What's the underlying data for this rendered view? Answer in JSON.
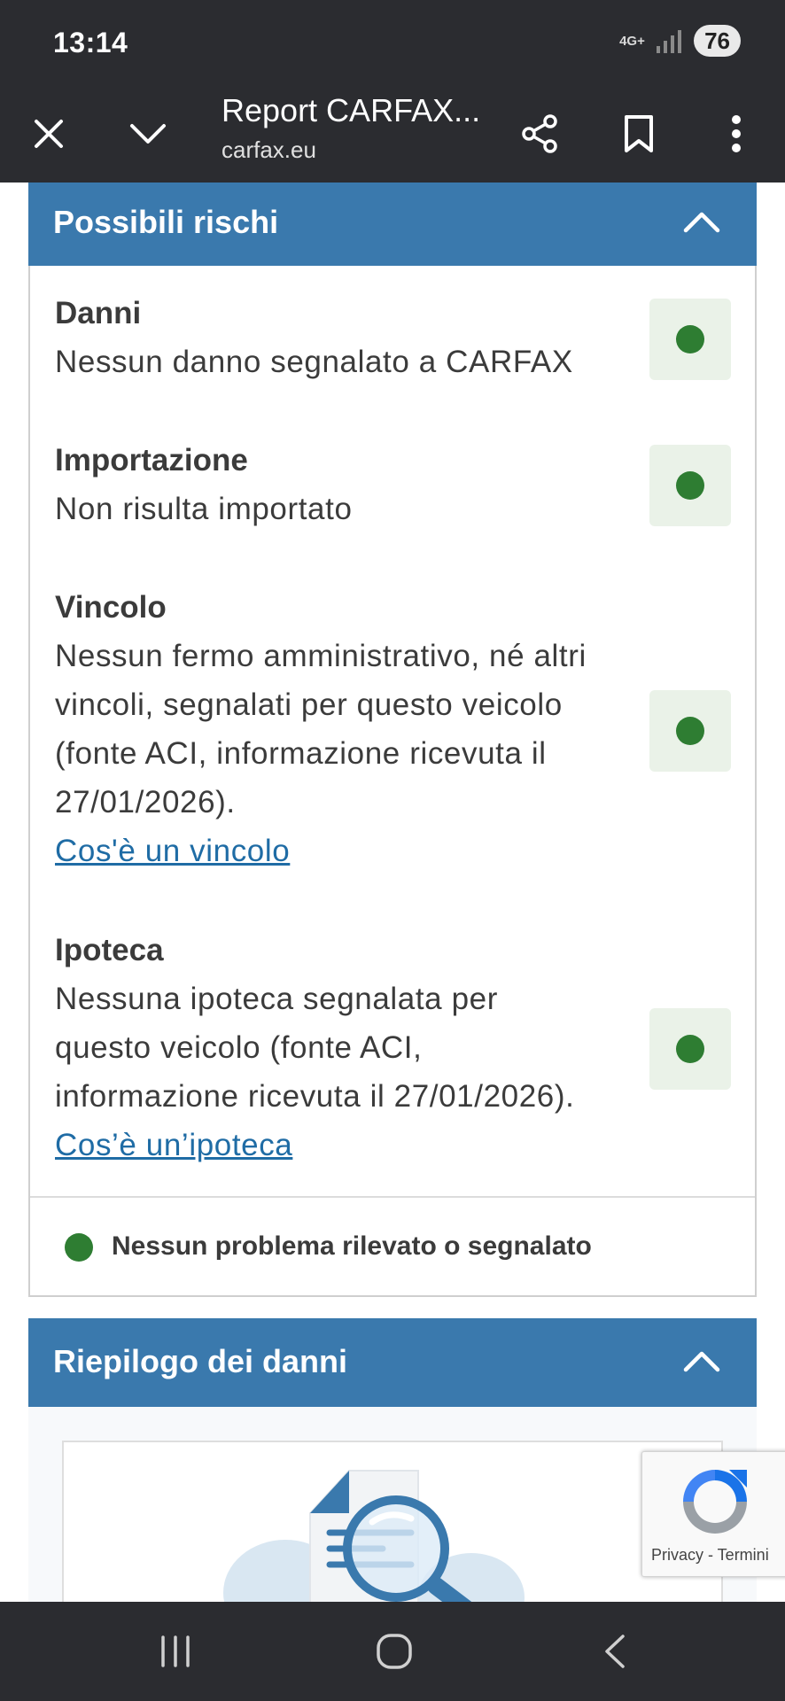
{
  "status_bar": {
    "time": "13:14",
    "network": "4G+",
    "battery": "76"
  },
  "browser": {
    "title": "Report CARFAX...",
    "url": "carfax.eu",
    "icons": [
      "close-icon",
      "chevron-down-icon",
      "share-icon",
      "bookmark-icon",
      "more-vert-icon"
    ]
  },
  "risks_section": {
    "title": "Possibili rischi",
    "items": [
      {
        "title": "Danni",
        "description": "Nessun danno segnalato a CARFAX",
        "status": "ok"
      },
      {
        "title": "Importazione",
        "description": "Non risulta importato",
        "status": "ok"
      },
      {
        "title": "Vincolo",
        "description": "Nessun fermo amministrativo, né altri vincoli, segnalati per questo veicolo (fonte ACI, informazione ricevuta il 27/01/2026).",
        "link": "Cos'è un vincolo",
        "status": "ok"
      },
      {
        "title": "Ipoteca",
        "description": "Nessuna ipoteca segnalata per questo veicolo (fonte ACI, informazione ricevuta il 27/01/2026).",
        "link": "Cos’è un’ipoteca",
        "status": "ok"
      }
    ],
    "legend": "Nessun problema rilevato o segnalato"
  },
  "damage_section": {
    "title": "Riepilogo dei danni"
  },
  "recaptcha": {
    "text": "Privacy - Termini"
  },
  "colors": {
    "header_blue": "#3a79ad",
    "ok_green": "#2e7d32",
    "link_blue": "#1f6ca5",
    "bar_dark": "#2b2c30"
  },
  "nav_bar": {
    "icons": [
      "recent-apps-icon",
      "home-icon",
      "back-icon"
    ]
  }
}
